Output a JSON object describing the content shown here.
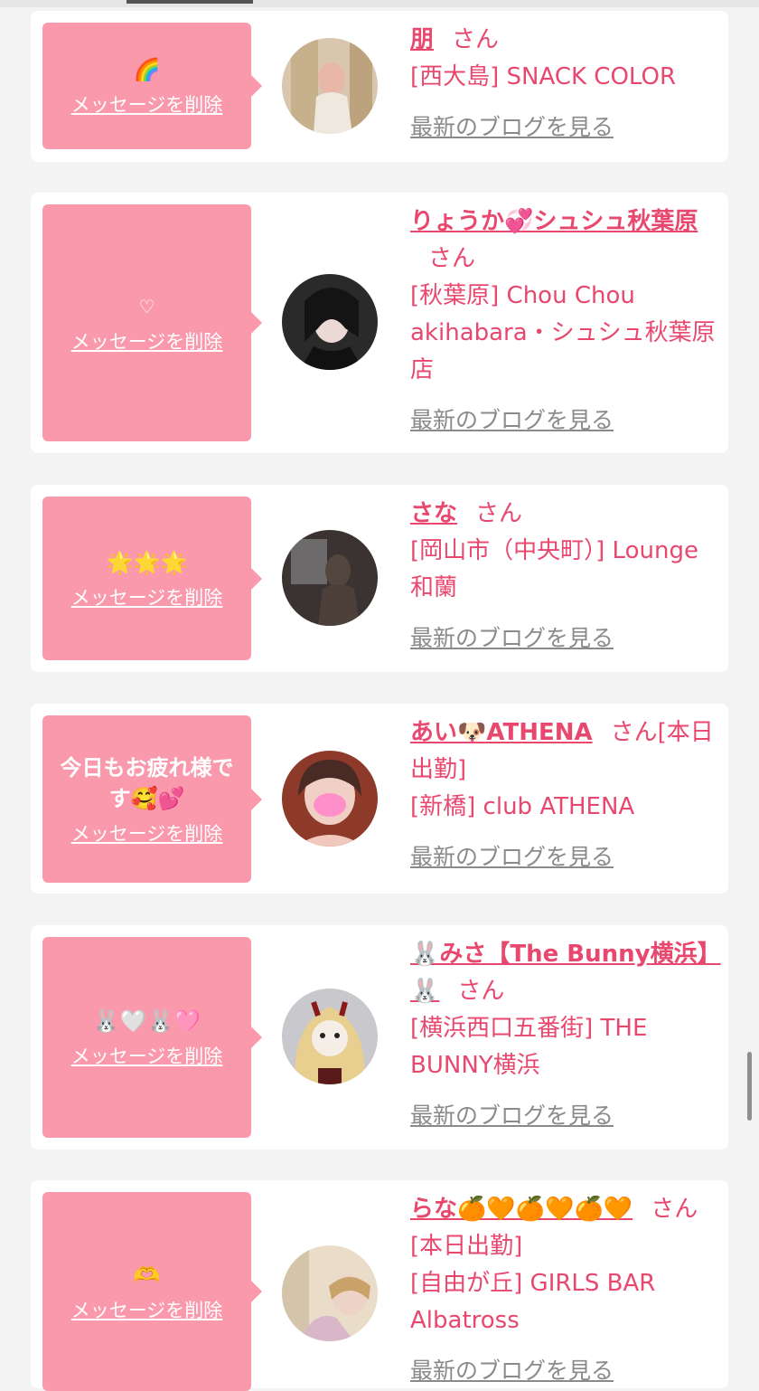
{
  "cards": [
    {
      "message": "🌈",
      "delete_label": "メッセージを削除",
      "name": "朋",
      "suffix": "さん",
      "shop": "[西大島] SNACK COLOR",
      "blog_label": "最新のブログを見る"
    },
    {
      "message": "♡",
      "delete_label": "メッセージを削除",
      "name": "りょうか💞シュシュ秋葉原",
      "suffix": "さん",
      "shop": "[秋葉原] Chou Chou akihabara・シュシュ秋葉原店",
      "blog_label": "最新のブログを見る"
    },
    {
      "message": "🌟🌟🌟",
      "delete_label": "メッセージを削除",
      "name": "さな",
      "suffix": "さん",
      "shop": "[岡山市（中央町）] Lounge 和蘭",
      "blog_label": "最新のブログを見る"
    },
    {
      "message": "今日もお疲れ様です🥰💕",
      "delete_label": "メッセージを削除",
      "name": "あい🐶ATHENA",
      "suffix": "さん[本日出勤]",
      "shop": "[新橋] club ATHENA",
      "blog_label": "最新のブログを見る"
    },
    {
      "message": "🐰🤍🐰🩷",
      "delete_label": "メッセージを削除",
      "name": "🐰みさ【The Bunny横浜】🐰",
      "suffix": "さん",
      "shop": "[横浜西口五番街] THE BUNNY横浜",
      "blog_label": "最新のブログを見る"
    },
    {
      "message": "🫶",
      "delete_label": "メッセージを削除",
      "name": "らな🍊🧡🍊🧡🍊🧡",
      "suffix": "さん[本日出勤]",
      "shop": "[自由が丘] GIRLS BAR Albatross",
      "blog_label": "最新のブログを見る"
    }
  ]
}
